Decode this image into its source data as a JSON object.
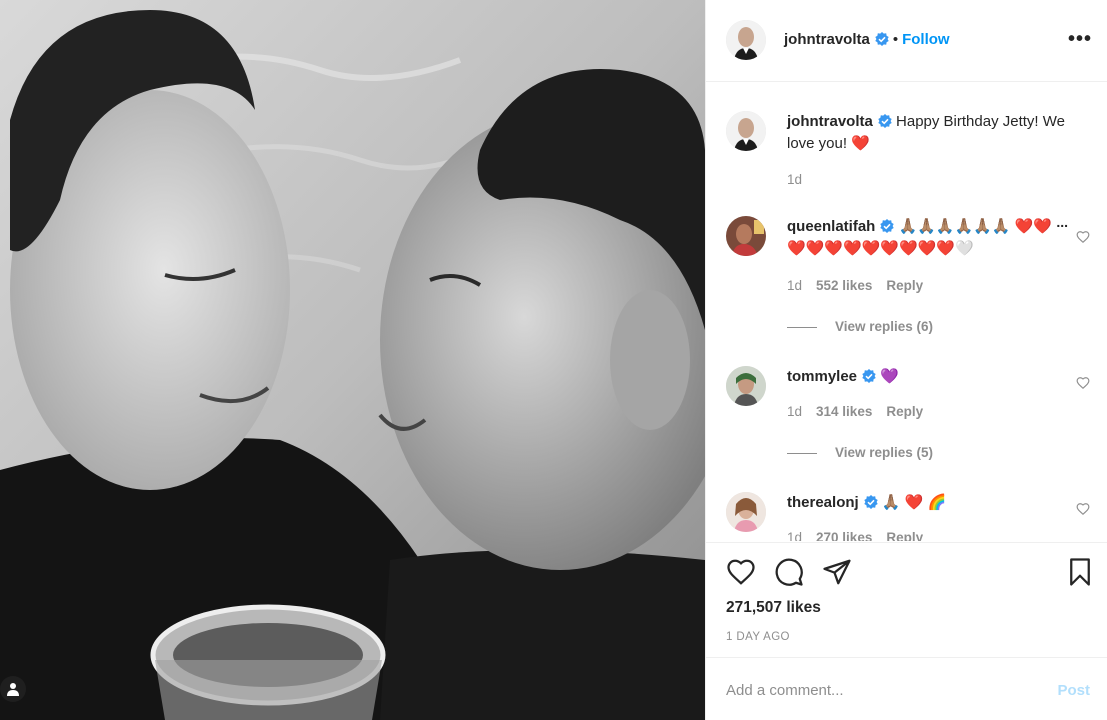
{
  "post": {
    "author": "johntravolta",
    "follow_label": "Follow",
    "separator": "•",
    "more_label": "•••",
    "verified": true
  },
  "caption": {
    "author": "johntravolta",
    "text": "Happy Birthday Jetty! We love you! ❤️",
    "time": "1d"
  },
  "comments": [
    {
      "user": "queenlatifah",
      "text": "🙏🏽🙏🏽🙏🏽🙏🏽🙏🏽🙏🏽 ❤️❤️❤️❤️❤️❤️❤️❤️❤️❤️❤️🤍",
      "time": "1d",
      "likes": "552 likes",
      "reply": "Reply",
      "more": "...",
      "view_replies": "View replies (6)"
    },
    {
      "user": "tommylee",
      "text": "💜",
      "time": "1d",
      "likes": "314 likes",
      "reply": "Reply",
      "view_replies": "View replies (5)"
    },
    {
      "user": "therealonj",
      "text": "🙏🏽 ❤️ 🌈",
      "time": "1d",
      "likes": "270 likes",
      "reply": "Reply"
    }
  ],
  "actions": {
    "like_icon": "heart-icon",
    "comment_icon": "comment-icon",
    "share_icon": "paper-plane-icon",
    "save_icon": "bookmark-icon"
  },
  "likes_count": "271,507 likes",
  "time_ago": "1 DAY AGO",
  "composer": {
    "placeholder": "Add a comment...",
    "post_label": "Post"
  },
  "colors": {
    "accent": "#0095f6",
    "post_disabled": "#b2dffc",
    "muted": "#8e8e8e",
    "text": "#262626"
  }
}
